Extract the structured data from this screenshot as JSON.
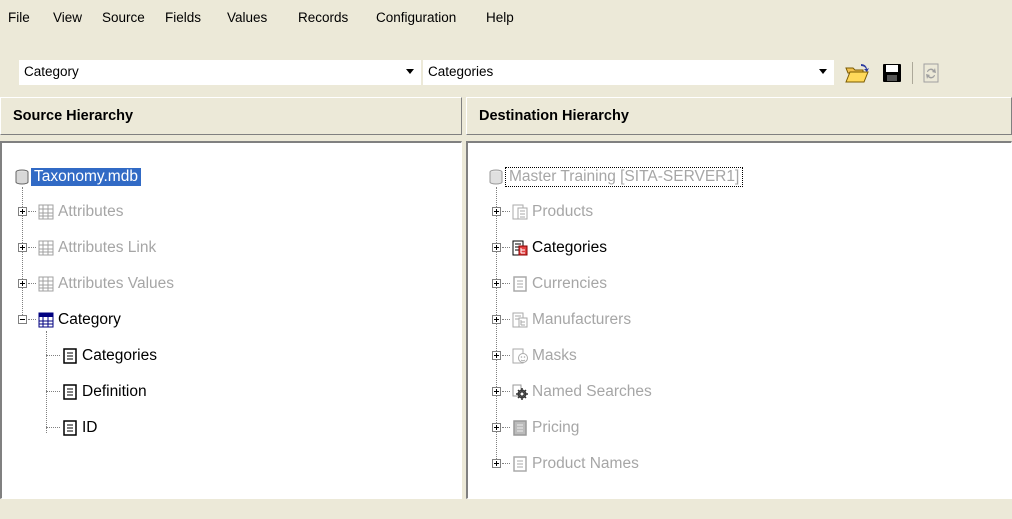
{
  "menu": {
    "items": [
      "File",
      "View",
      "Source",
      "Fields",
      "Values",
      "Records",
      "Configuration",
      "Help"
    ]
  },
  "toolbar": {
    "source_table": "Category",
    "destination_table": "Categories",
    "buttons": [
      "open-folder-icon",
      "save-icon",
      "refresh-icon"
    ]
  },
  "source": {
    "header": "Source Hierarchy",
    "root": "Taxonomy.mdb",
    "items": [
      {
        "label": "Attributes"
      },
      {
        "label": "Attributes Link"
      },
      {
        "label": "Attributes Values"
      },
      {
        "label": "Category"
      }
    ],
    "category_fields": [
      "Categories",
      "Definition",
      "ID"
    ]
  },
  "destination": {
    "header": "Destination Hierarchy",
    "root": "Master Training [SITA-SERVER1]",
    "items": [
      {
        "label": "Products",
        "active": false
      },
      {
        "label": "Categories",
        "active": true
      },
      {
        "label": "Currencies",
        "active": false
      },
      {
        "label": "Manufacturers",
        "active": false
      },
      {
        "label": "Masks",
        "active": false
      },
      {
        "label": "Named Searches",
        "active": false
      },
      {
        "label": "Pricing",
        "active": false
      },
      {
        "label": "Product Names",
        "active": false
      }
    ]
  },
  "colors": {
    "selection": "#316ac5",
    "disabled_text": "#a6a6a6",
    "chrome": "#ece9d8"
  }
}
